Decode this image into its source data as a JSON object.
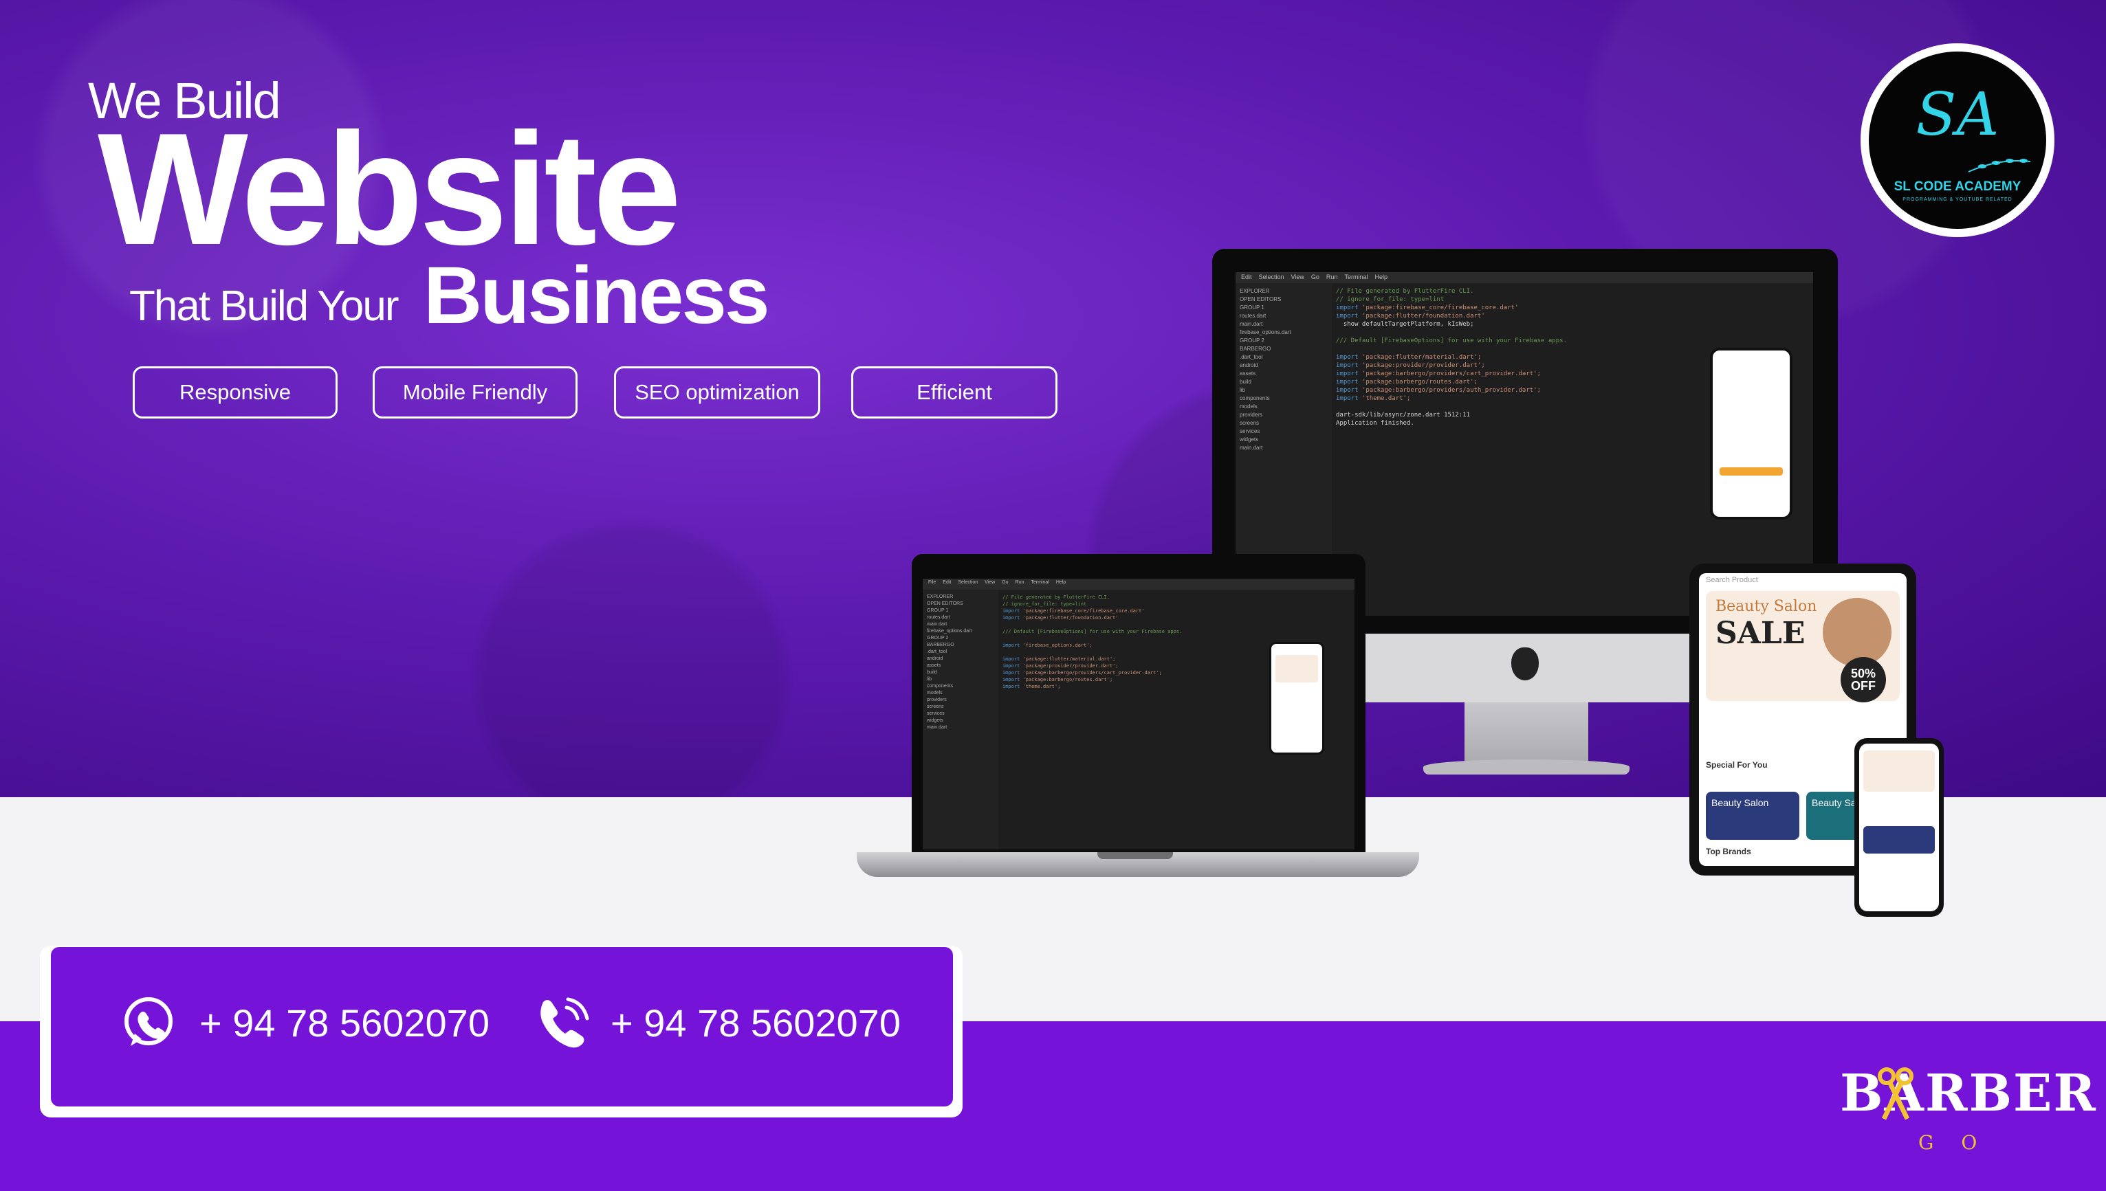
{
  "headline": {
    "line1": "We Build",
    "line2": "Website",
    "line3": "That Build Your",
    "line4": "Business"
  },
  "features": [
    "Responsive",
    "Mobile Friendly",
    "SEO optimization",
    "Efficient"
  ],
  "logo": {
    "monogram": "SA",
    "name": "SL CODE ACADEMY",
    "tagline": "PROGRAMMING & YOUTUBE RELATED"
  },
  "contact": {
    "whatsapp": "+ 94 78 5602070",
    "phone": "+ 94 78 5602070"
  },
  "brand": {
    "barber": "BARBER",
    "go": "GO"
  },
  "mockup": {
    "sale_title": "Beauty Salon",
    "sale_big": "SALE",
    "sale_badge": "50% OFF",
    "special": "Special For You",
    "top_brands": "Top Brands",
    "tile1": "Beauty Salon",
    "tile2": "Beauty Salon",
    "search": "Search Product"
  },
  "colors": {
    "accent": "#7514d8",
    "logo_cyan": "#33d3e8",
    "brand_gold": "#f2c230"
  }
}
